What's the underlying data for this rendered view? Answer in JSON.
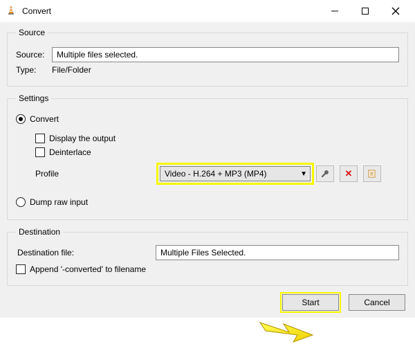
{
  "titlebar": {
    "title": "Convert"
  },
  "source": {
    "legend": "Source",
    "source_label": "Source:",
    "source_value": "Multiple files selected.",
    "type_label": "Type:",
    "type_value": "File/Folder"
  },
  "settings": {
    "legend": "Settings",
    "convert_radio": "Convert",
    "display_output": "Display the output",
    "deinterlace": "Deinterlace",
    "profile_label": "Profile",
    "profile_value": "Video - H.264 + MP3 (MP4)",
    "dump_radio": "Dump raw input"
  },
  "destination": {
    "legend": "Destination",
    "file_label": "Destination file:",
    "file_value": "Multiple Files Selected.",
    "append_label": "Append '-converted' to filename"
  },
  "buttons": {
    "start": "Start",
    "cancel": "Cancel"
  }
}
